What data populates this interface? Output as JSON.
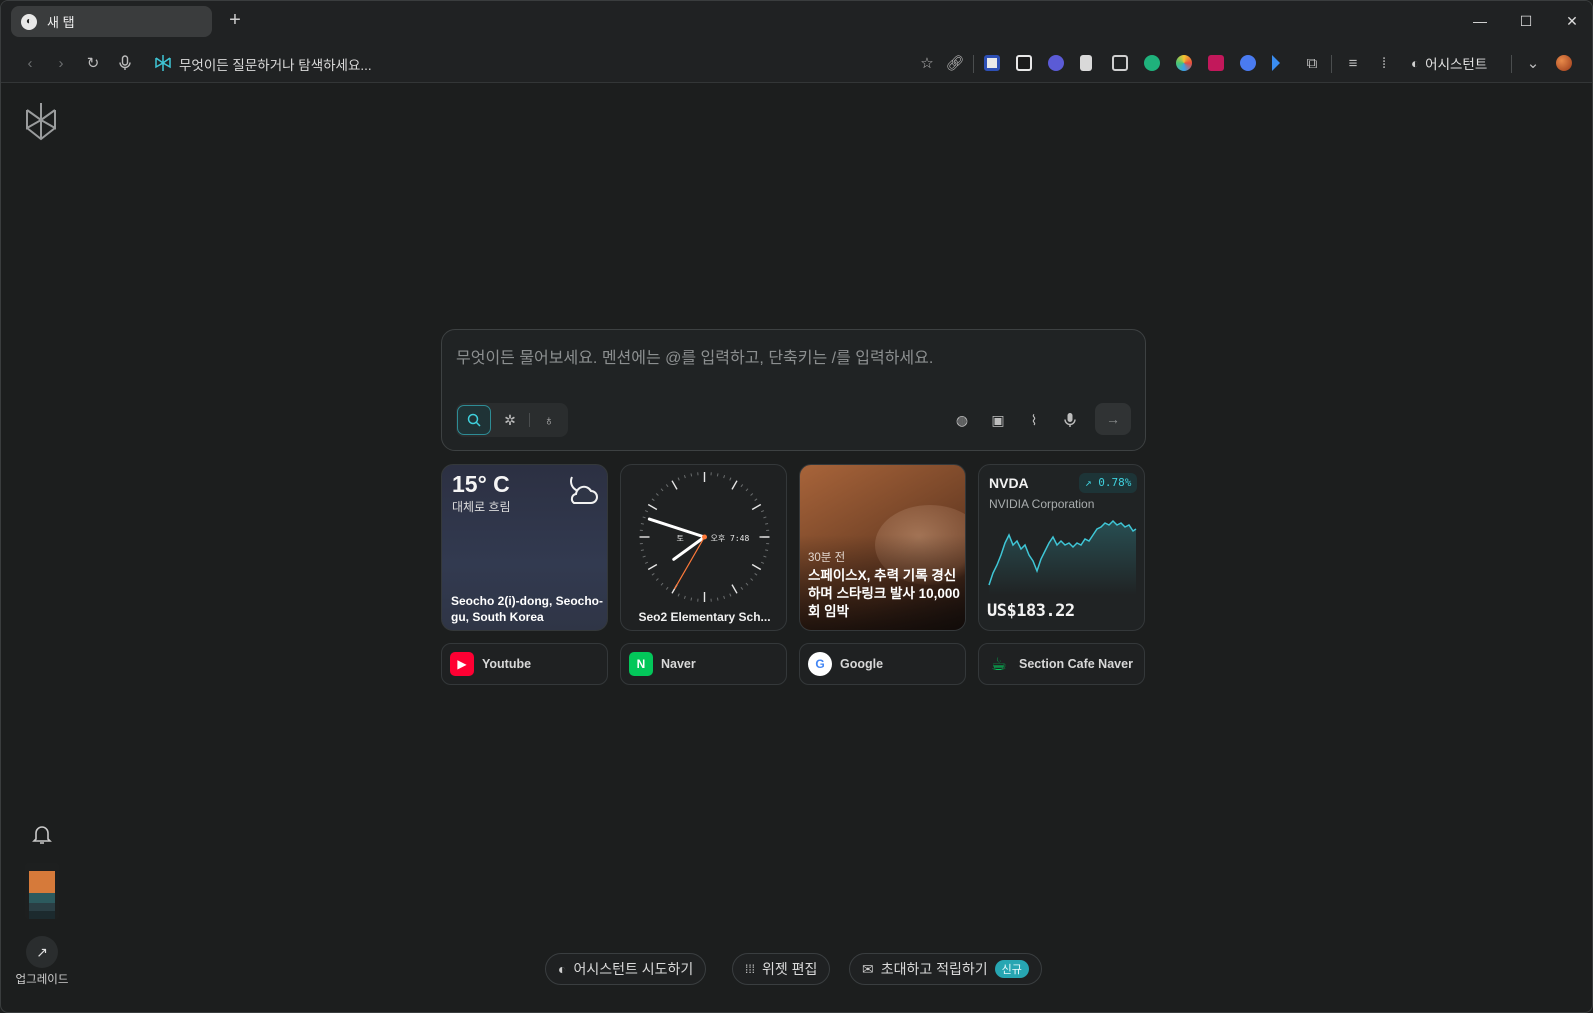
{
  "browser": {
    "tab_title": "새 탭",
    "new_tab_symbol": "+",
    "address_text": "무엇이든 질문하거나 탐색하세요...",
    "assistant_label": "어시스턴트"
  },
  "search": {
    "placeholder": "무엇이든 물어보세요. 멘션에는 @를 입력하고, 단축키는 /를 입력하세요."
  },
  "weather": {
    "temperature": "15° C",
    "condition": "대체로 흐림",
    "location": "Seocho 2(i)-dong, Seocho-gu, South Korea"
  },
  "clock": {
    "day_label": "토",
    "time_text": "오후 7:48",
    "location": "Seo2 Elementary Sch..."
  },
  "news": {
    "time_ago": "30분 전",
    "headline": "스페이스X, 추력 기록 경신하며 스타링크 발사 10,000회 임박"
  },
  "stock": {
    "ticker": "NVDA",
    "company": "NVIDIA Corporation",
    "change": "↗ 0.78%",
    "price": "US$183.22",
    "color": "#3fd0dd"
  },
  "shortcuts": [
    {
      "label": "Youtube",
      "color": "#ff0033"
    },
    {
      "label": "Naver",
      "color": "#03c75a"
    },
    {
      "label": "Google",
      "color": "#ffffff"
    },
    {
      "label": "Section Cafe Naver",
      "color": "#03c75a"
    }
  ],
  "sidebar": {
    "upgrade_label": "업그레이드"
  },
  "bottom_actions": {
    "try_assistant": "어시스턴트 시도하기",
    "edit_widgets": "위젯 편집",
    "invite": "초대하고 적립하기",
    "new_badge": "신규"
  }
}
